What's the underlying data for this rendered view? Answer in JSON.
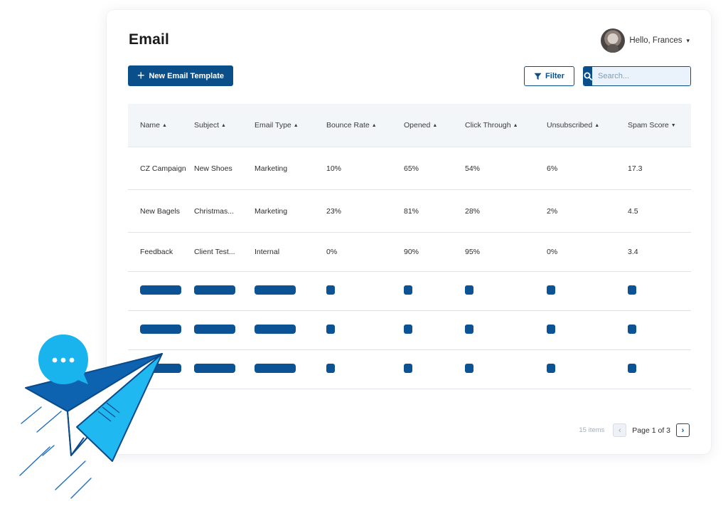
{
  "page": {
    "title": "Email"
  },
  "user": {
    "greeting": "Hello, Frances",
    "caret": "▾"
  },
  "toolbar": {
    "new_template_label": "New Email Template",
    "filter_label": "Filter",
    "search_placeholder": "Search..."
  },
  "table": {
    "columns": [
      {
        "label": "Name",
        "sort": "▲"
      },
      {
        "label": "Subject",
        "sort": "▲"
      },
      {
        "label": "Email Type",
        "sort": "▲"
      },
      {
        "label": "Bounce Rate",
        "sort": "▲"
      },
      {
        "label": "Opened",
        "sort": "▲"
      },
      {
        "label": "Click Through",
        "sort": "▲"
      },
      {
        "label": "Unsubscribed",
        "sort": "▲"
      },
      {
        "label": "Spam Score",
        "sort": "▼"
      }
    ],
    "rows": [
      [
        "CZ Campaign",
        "New Shoes",
        "Marketing",
        "10%",
        "65%",
        "54%",
        "6%",
        "17.3"
      ],
      [
        "New Bagels",
        "Christmas...",
        "Marketing",
        "23%",
        "81%",
        "28%",
        "2%",
        "4.5"
      ],
      [
        "Feedback",
        "Client Test...",
        "Internal",
        "0%",
        "90%",
        "95%",
        "0%",
        "3.4"
      ]
    ]
  },
  "pagination": {
    "items_count": "15 items",
    "page_label": "Page 1 of 3",
    "prev": "‹",
    "next": "›"
  },
  "colors": {
    "primary": "#0b4f8a",
    "skeleton": "#0b5394",
    "bubble": "#19b4ee",
    "plane_dark": "#0d63b0",
    "plane_light": "#1fb8f0"
  },
  "icons": {
    "new_template": "plus-icon",
    "filter": "funnel-icon",
    "search": "magnifier-icon",
    "prev": "chevron-left-icon",
    "next": "chevron-right-icon",
    "chat": "chat-bubble-icon",
    "plane": "paper-plane-icon"
  }
}
